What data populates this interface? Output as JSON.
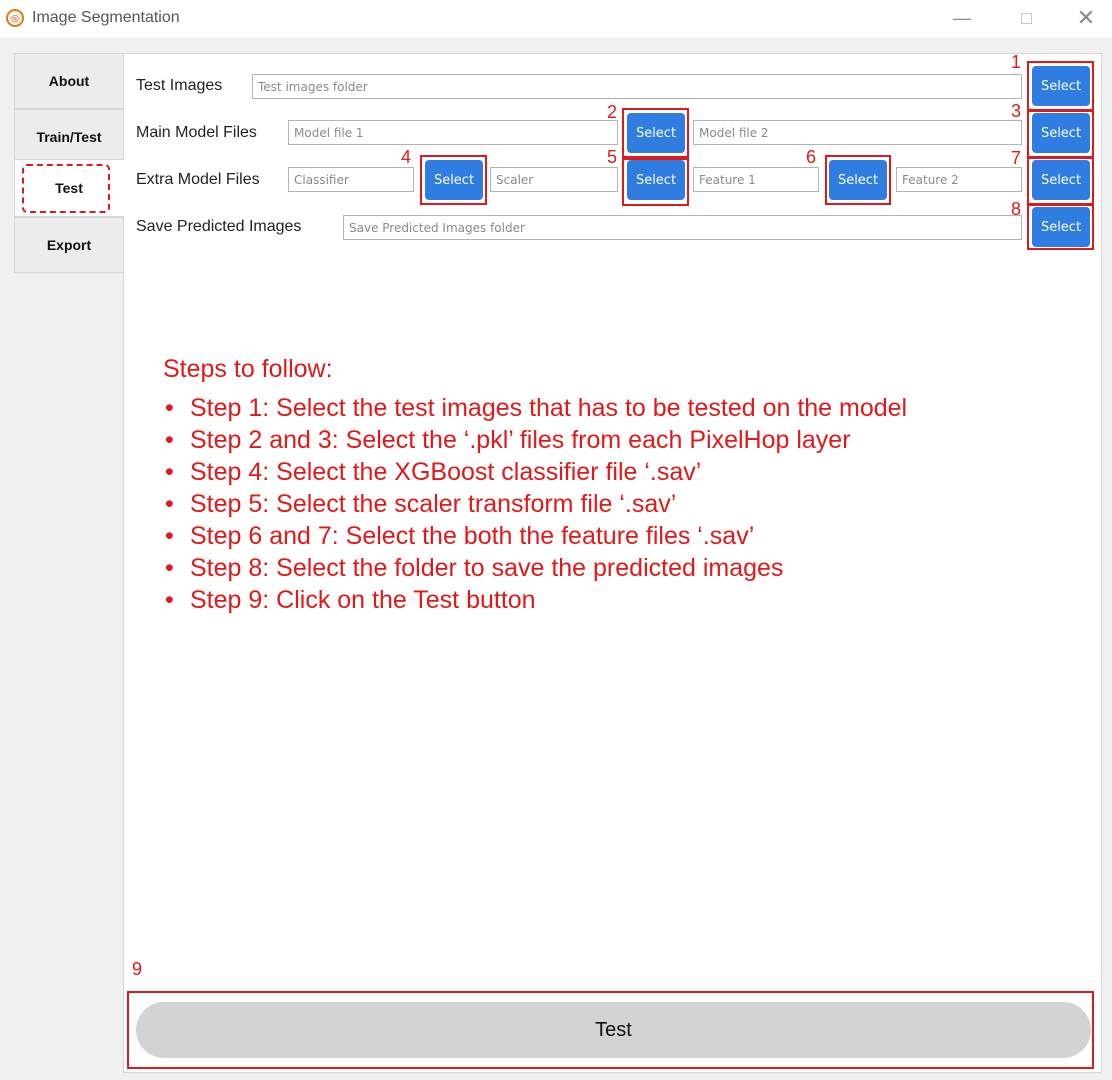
{
  "window": {
    "title": "Image Segmentation",
    "icon": "logo-icon",
    "minimize": "—",
    "close": "✕"
  },
  "tabs": [
    {
      "label": "About"
    },
    {
      "label": "Train/Test"
    },
    {
      "label": "Test"
    },
    {
      "label": "Export"
    }
  ],
  "active_tab": "Test",
  "form": {
    "test_images": {
      "label": "Test Images",
      "placeholder": "Test images folder"
    },
    "main_model": {
      "label": "Main Model Files",
      "placeholder_1": "Model file 1",
      "placeholder_2": "Model file 2"
    },
    "extra_model": {
      "label": "Extra Model Files",
      "classifier_placeholder": "Classifier",
      "scaler_placeholder": "Scaler",
      "feature1_placeholder": "Feature 1",
      "feature2_placeholder": "Feature 2"
    },
    "save_predicted": {
      "label": "Save Predicted Images",
      "placeholder": "Save Predicted Images folder"
    },
    "select_label": "Select"
  },
  "annotations": [
    "1",
    "2",
    "3",
    "4",
    "5",
    "6",
    "7",
    "8",
    "9"
  ],
  "steps": {
    "heading": "Steps to follow:",
    "items": [
      "Step 1: Select the test images that has to be tested on the model",
      "Step 2 and 3: Select the ‘.pkl’ files from each PixelHop layer",
      "Step 4: Select the XGBoost classifier file ‘.sav’",
      "Step 5: Select the scaler transform file ‘.sav’",
      "Step 6 and 7: Select the both the feature files ‘.sav’",
      "Step 8: Select the folder to save the predicted images",
      "Step 9: Click on the Test button"
    ]
  },
  "test_button": {
    "label": "Test"
  },
  "colors": {
    "accent": "#2f7de1",
    "annotation": "#e01a1a",
    "test_button": "#d3d3d3"
  }
}
